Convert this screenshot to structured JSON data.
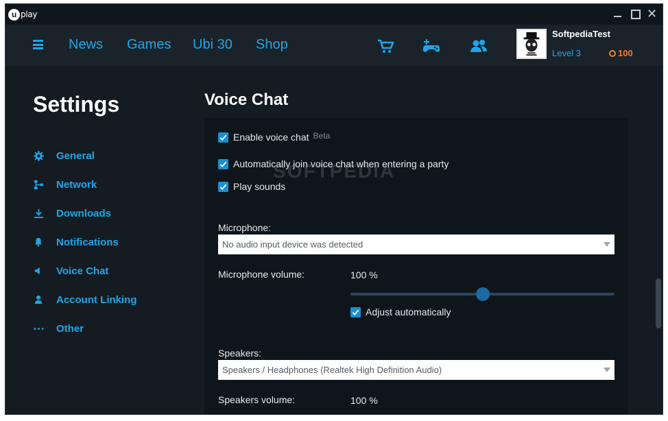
{
  "app": {
    "logo_text": "play",
    "logo_mark": "u"
  },
  "window_controls": {
    "minimize": "minimize",
    "maximize": "maximize",
    "close": "✕"
  },
  "nav": {
    "links": [
      "News",
      "Games",
      "Ubi 30",
      "Shop"
    ],
    "icons": [
      "cart-icon",
      "add-game-icon",
      "friends-icon"
    ]
  },
  "user": {
    "name": "SoftpediaTest",
    "level": "Level 3",
    "coins": "100",
    "coin_icon": "ubi-coin-icon"
  },
  "sidebar": {
    "title": "Settings",
    "items": [
      {
        "label": "General",
        "icon": "gear-icon"
      },
      {
        "label": "Network",
        "icon": "network-icon"
      },
      {
        "label": "Downloads",
        "icon": "download-icon"
      },
      {
        "label": "Notifications",
        "icon": "bell-icon"
      },
      {
        "label": "Voice Chat",
        "icon": "speaker-icon"
      },
      {
        "label": "Account Linking",
        "icon": "person-icon"
      },
      {
        "label": "Other",
        "icon": "more-dots-icon"
      }
    ]
  },
  "voice_chat": {
    "title": "Voice Chat",
    "checkboxes": [
      {
        "label": "Enable voice chat",
        "badge": "Beta",
        "checked": true
      },
      {
        "label": "Automatically join voice chat when entering a party",
        "checked": true
      },
      {
        "label": "Play sounds",
        "checked": true
      }
    ],
    "microphone": {
      "label": "Microphone:",
      "selected": "No audio input device was detected",
      "volume_label": "Microphone volume:",
      "volume_value": "100 %",
      "slider_level": 0.5,
      "adjust_label": "Adjust automatically",
      "adjust_checked": true
    },
    "speakers": {
      "label": "Speakers:",
      "selected": "Speakers / Headphones (Realtek High Definition Audio)",
      "volume_label": "Speakers volume:",
      "volume_value": "100 %"
    }
  },
  "watermark": "SOFTPEDIA",
  "colors": {
    "accent": "#1fa6e8",
    "coin": "#f0802c",
    "background": "#141c22",
    "panel": "#0f161b"
  }
}
